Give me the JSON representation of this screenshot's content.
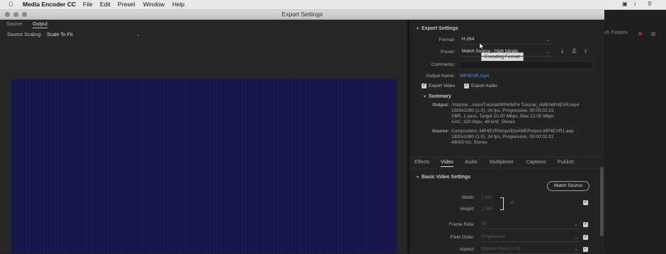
{
  "menubar": {
    "apple": "",
    "app_name": "Media Encoder CC",
    "items": [
      "File",
      "Edit",
      "Preset",
      "Window",
      "Help"
    ]
  },
  "window": {
    "title": "Export Settings"
  },
  "background_app": {
    "watch_folders": "ch Folders"
  },
  "left": {
    "tabs": [
      "Source",
      "Output"
    ],
    "active_tab": "Output",
    "source_scaling_label": "Source Scaling:",
    "source_scaling_value": "Scale To Fit"
  },
  "export_settings": {
    "header": "Export Settings",
    "format_label": "Format:",
    "format_value": "H.264",
    "tooltip": "Encoding Format",
    "preset_label": "Preset:",
    "preset_value": "Match Source - High bitrate",
    "comments_label": "Comments:",
    "output_name_label": "Output Name:",
    "output_name_value": "MP4EVR.mp4",
    "export_video_label": "Export Video",
    "export_audio_label": "Export Audio",
    "summary_header": "Summary",
    "summary_output_label": "Output:",
    "summary_output_lines": [
      "/Volume...otion/Tutorial/MP4/MP4 Tutorial_AME/MP4EVR.mp4",
      "1920x1080 (1.0), 24 fps, Progressive, 00:00:02:22",
      "VBR, 1 pass, Target 10.00 Mbps, Max 12.00 Mbps",
      "AAC, 320 kbps, 48 kHz, Stereo"
    ],
    "summary_source_label": "Source:",
    "summary_source_lines": [
      "Composition, MP4EVR/tmpAEtoAMEProject-MP4EVR1.aep",
      "1920x1080 (1.0), 24 fps, Progressive, 00:00:02:22",
      "48000 Hz, Stereo"
    ]
  },
  "bottom_tabs": [
    "Effects",
    "Video",
    "Audio",
    "Multiplexer",
    "Captions",
    "Publish"
  ],
  "active_bottom_tab": "Video",
  "video": {
    "header": "Basic Video Settings",
    "match_source": "Match Source",
    "width_label": "Width:",
    "width_value": "1,920",
    "height_label": "Height:",
    "height_value": "1,080",
    "frame_rate_label": "Frame Rate:",
    "frame_rate_value": "24",
    "field_order_label": "Field Order:",
    "field_order_value": "Progressive",
    "aspect_label": "Aspect:",
    "aspect_value": "Square Pixels (1.0)"
  },
  "colors": {
    "preview": "#15154a",
    "link": "#3b9bff",
    "panel": "#232323"
  }
}
